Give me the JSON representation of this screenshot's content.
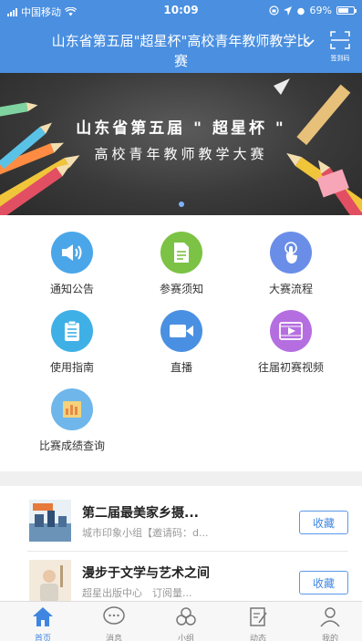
{
  "status_bar": {
    "carrier": "中国移动",
    "time": "10:09",
    "battery": "69%",
    "battery_level": 0.69
  },
  "header": {
    "title": "山东省第五届\"超星杯\"高校青年教师教学比赛",
    "scan_label": "签到码",
    "accent_color": "#4a8fe0"
  },
  "banner": {
    "line1": "山东省第五届 \" 超星杯 \"",
    "line2": "高校青年教师教学大赛",
    "page_index": 1,
    "page_count": 1
  },
  "menu": [
    {
      "label": "通知公告",
      "icon": "speaker-icon",
      "color": "#4aa6e8"
    },
    {
      "label": "参赛须知",
      "icon": "document-icon",
      "color": "#7cc244"
    },
    {
      "label": "大赛流程",
      "icon": "touch-icon",
      "color": "#6a8ee8"
    },
    {
      "label": "使用指南",
      "icon": "clipboard-icon",
      "color": "#3fb0e6"
    },
    {
      "label": "直播",
      "icon": "video-camera-icon",
      "color": "#4a90e2"
    },
    {
      "label": "往届初赛视频",
      "icon": "film-icon",
      "color": "#b56ee0"
    },
    {
      "label": "比赛成绩查询",
      "icon": "chart-icon",
      "color": "#6fb7ea"
    }
  ],
  "groups": [
    {
      "name": "第二届最美家乡摄...",
      "sub": "城市印象小组【邀请码：d...",
      "button": "收藏"
    },
    {
      "name": "漫步于文学与艺术之间",
      "sub": "超星出版中心　订阅量...",
      "button": "收藏"
    }
  ],
  "tabbar": [
    {
      "label": "首页",
      "icon": "home-icon",
      "active": true
    },
    {
      "label": "消息",
      "icon": "message-icon",
      "active": false
    },
    {
      "label": "小组",
      "icon": "group-icon",
      "active": false
    },
    {
      "label": "动态",
      "icon": "edit-icon",
      "active": false
    },
    {
      "label": "我的",
      "icon": "user-icon",
      "active": false
    }
  ]
}
